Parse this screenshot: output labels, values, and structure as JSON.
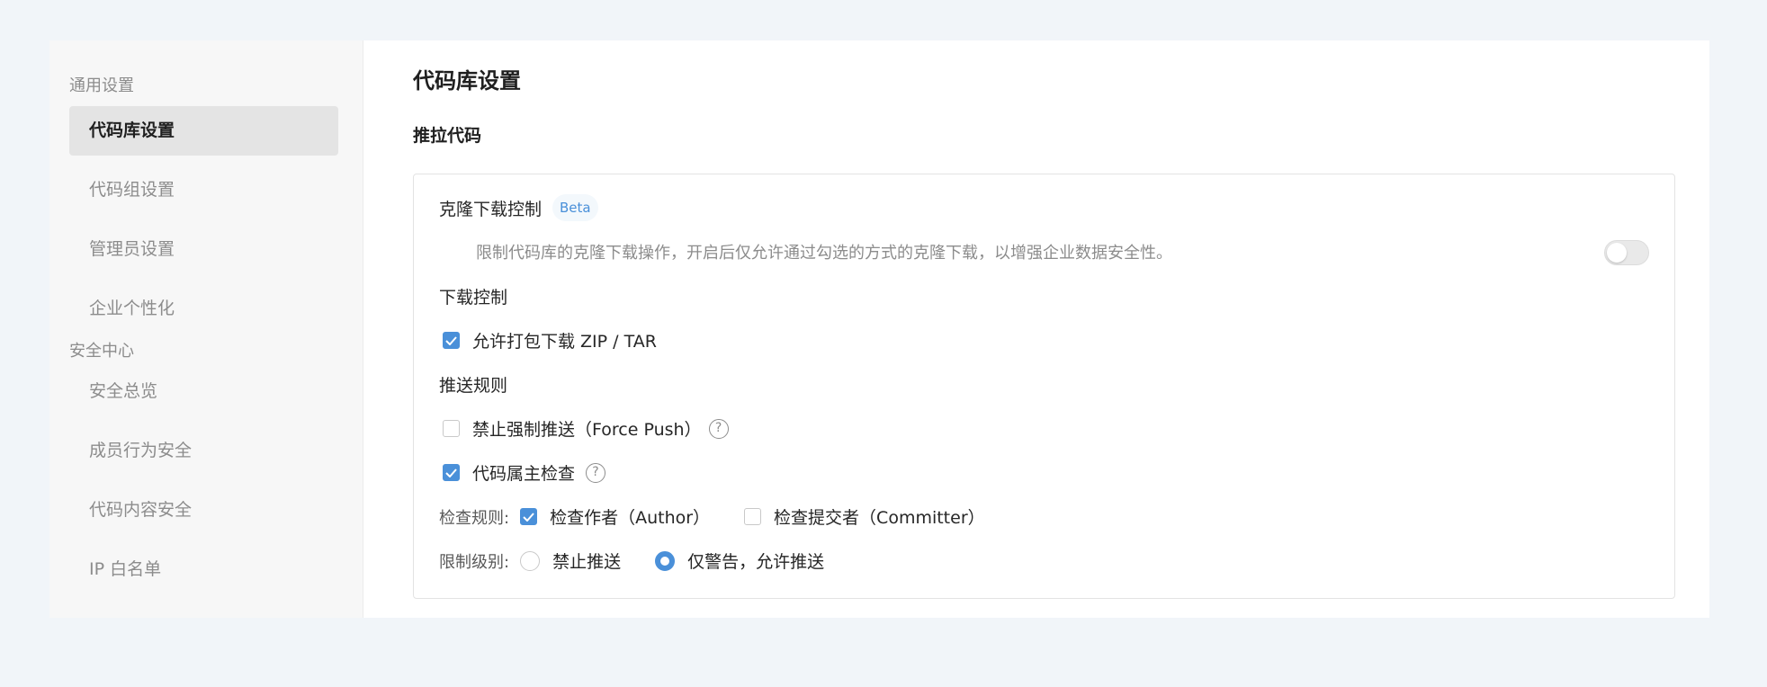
{
  "sidebar": {
    "groups": [
      {
        "title": "通用设置",
        "items": [
          {
            "label": "代码库设置",
            "active": true
          },
          {
            "label": "代码组设置"
          },
          {
            "label": "管理员设置"
          },
          {
            "label": "企业个性化"
          }
        ]
      },
      {
        "title": "安全中心",
        "items": [
          {
            "label": "安全总览"
          },
          {
            "label": "成员行为安全"
          },
          {
            "label": "代码内容安全"
          },
          {
            "label": "IP 白名单"
          }
        ]
      }
    ]
  },
  "main": {
    "page_title": "代码库设置",
    "section_title": "推拉代码",
    "clone_control": {
      "title": "克隆下载控制",
      "badge": "Beta",
      "description": "限制代码库的克隆下载操作，开启后仅允许通过勾选的方式的克隆下载，以增强企业数据安全性。",
      "enabled": false
    },
    "download_control": {
      "title": "下载控制",
      "allow_archive": {
        "label": "允许打包下载 ZIP / TAR",
        "checked": true
      }
    },
    "push_rules": {
      "title": "推送规则",
      "force_push": {
        "label": "禁止强制推送（Force Push）",
        "checked": false
      },
      "owner_check": {
        "label": "代码属主检查",
        "checked": true
      },
      "check_rules": {
        "label": "检查规则:",
        "author": {
          "label": "检查作者（Author）",
          "checked": true
        },
        "committer": {
          "label": "检查提交者（Committer）",
          "checked": false
        }
      },
      "restriction": {
        "label": "限制级别:",
        "forbid": {
          "label": "禁止推送",
          "selected": false
        },
        "warn": {
          "label": "仅警告，允许推送",
          "selected": true
        }
      }
    }
  },
  "colors": {
    "accent": "#4a90d9",
    "page_bg": "#f1f5f9",
    "sidebar_bg": "#f7f7f7",
    "active_bg": "#e4e4e4"
  }
}
